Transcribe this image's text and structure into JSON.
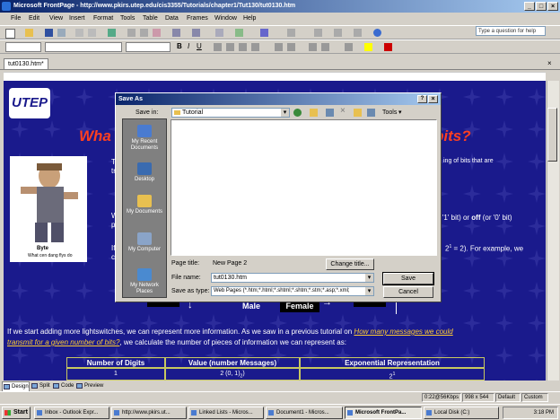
{
  "window": {
    "title": "Microsoft FrontPage - http://www.pkirs.utep.edu/cis3355/Tutorials/chapter1/Tut130/tut0130.htm",
    "help_placeholder": "Type a question for help"
  },
  "menu": [
    "File",
    "Edit",
    "View",
    "Insert",
    "Format",
    "Tools",
    "Table",
    "Data",
    "Frames",
    "Window",
    "Help"
  ],
  "document_tab": "tut0130.htm*",
  "page": {
    "logo": "UTEP",
    "heading_left": "Wha",
    "heading_right": "bits?",
    "right_text_1": "ing of bits that are",
    "right_text_2": "r '1' bit) or",
    "right_text_2b": "off",
    "right_text_2c": "(or '0' bit)",
    "right_text_3": "2",
    "right_text_3_sup": "1",
    "right_text_3b": "= 2).  For example, we",
    "caption_name": "Byte",
    "caption_sub": "What cen dang flys do",
    "male": "Male",
    "female": "Female",
    "para_1": "If we start adding more lightswitches, we can represent more information. As we saw in a previous tutorial on",
    "para_link": "How many messages we could",
    "para_link_2": "transmit for a given number of bits?",
    "para_2": ", we calculate the number of pieces of information we can represent as:",
    "table_headers": [
      "Number of Digits",
      "Value (number Messages)",
      "Exponential Representation"
    ],
    "table_row": [
      "1",
      "2 (0,  1)",
      "2"
    ],
    "table_row_sub": "2",
    "table_row_sup": "1"
  },
  "dialog": {
    "title": "Save As",
    "save_in_label": "Save in:",
    "save_in_value": "Tutorial",
    "tools_label": "Tools",
    "places": [
      "My Recent Documents",
      "Desktop",
      "My Documents",
      "My Computer",
      "My Network Places"
    ],
    "page_title_label": "Page title:",
    "page_title_value": "New Page 2",
    "change_title_button": "Change title...",
    "file_name_label": "File name:",
    "file_name_value": "tut0130.htm",
    "save_as_type_label": "Save as type:",
    "save_as_type_value": "Web Pages (*.htm;*.html;*.shtml;*.shtm;*.stm;*.asp;*.xml;",
    "save_button": "Save",
    "cancel_button": "Cancel"
  },
  "view_tabs": [
    "Design",
    "Split",
    "Code",
    "Preview"
  ],
  "status": {
    "speed": "0:22@56Kbps",
    "size": "998 x 544",
    "mode": "Default",
    "custom": "Custom"
  },
  "taskbar": {
    "start": "Start",
    "tasks": [
      "Inbox - Outlook Expr...",
      "http://www.pkirs.ut...",
      "Linked Lists - Micros...",
      "Document1 - Micros...",
      "Microsoft FrontPa...",
      "Local Disk (C:)"
    ],
    "clock": "3:18 PM"
  },
  "colors": {
    "page_background": "#1a1a8c",
    "heading": "#ff4020",
    "link": "#ffcc33",
    "titlebar": "#0a246a"
  }
}
